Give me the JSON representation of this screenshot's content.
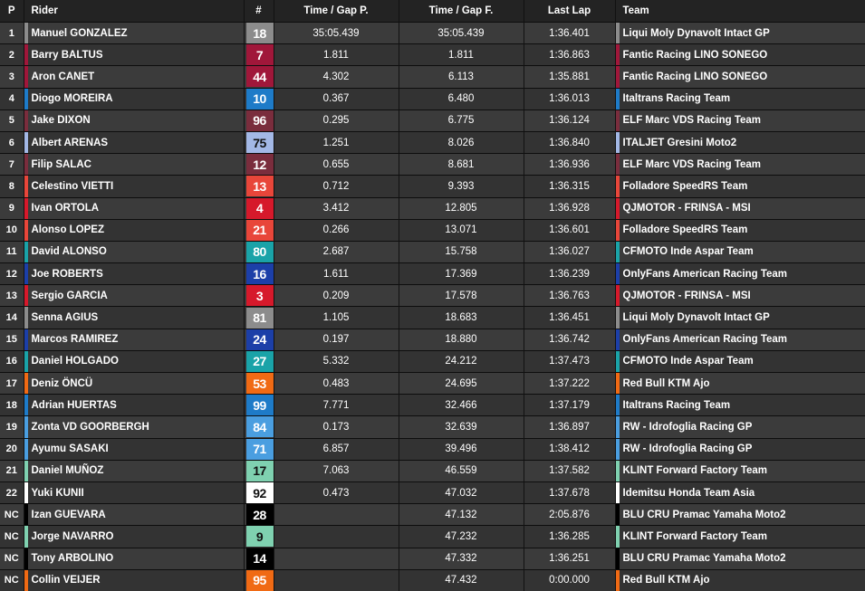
{
  "headers": {
    "p": "P",
    "rider": "Rider",
    "num": "#",
    "gap_prev": "Time / Gap P.",
    "gap_first": "Time / Gap F.",
    "last_lap": "Last Lap",
    "team": "Team"
  },
  "rows": [
    {
      "pos": "1",
      "rider": "Manuel GONZALEZ",
      "num": "18",
      "gap_prev": "35:05.439",
      "gap_first": "35:05.439",
      "last_lap": "1:36.401",
      "team": "Liqui Moly Dynavolt Intact GP",
      "color": "#8c8c8c",
      "text": "#ffffff"
    },
    {
      "pos": "2",
      "rider": "Barry BALTUS",
      "num": "7",
      "gap_prev": "1.811",
      "gap_first": "1.811",
      "last_lap": "1:36.863",
      "team": "Fantic Racing LINO SONEGO",
      "color": "#a0173a",
      "text": "#ffffff"
    },
    {
      "pos": "3",
      "rider": "Aron CANET",
      "num": "44",
      "gap_prev": "4.302",
      "gap_first": "6.113",
      "last_lap": "1:35.881",
      "team": "Fantic Racing LINO SONEGO",
      "color": "#a0173a",
      "text": "#ffffff"
    },
    {
      "pos": "4",
      "rider": "Diogo MOREIRA",
      "num": "10",
      "gap_prev": "0.367",
      "gap_first": "6.480",
      "last_lap": "1:36.013",
      "team": "Italtrans Racing Team",
      "color": "#1e7bc8",
      "text": "#ffffff"
    },
    {
      "pos": "5",
      "rider": "Jake DIXON",
      "num": "96",
      "gap_prev": "0.295",
      "gap_first": "6.775",
      "last_lap": "1:36.124",
      "team": "ELF Marc VDS Racing Team",
      "color": "#7a2d3d",
      "text": "#ffffff"
    },
    {
      "pos": "6",
      "rider": "Albert ARENAS",
      "num": "75",
      "gap_prev": "1.251",
      "gap_first": "8.026",
      "last_lap": "1:36.840",
      "team": "ITALJET Gresini Moto2",
      "color": "#a3b8e6",
      "text": "#111111"
    },
    {
      "pos": "7",
      "rider": "Filip SALAC",
      "num": "12",
      "gap_prev": "0.655",
      "gap_first": "8.681",
      "last_lap": "1:36.936",
      "team": "ELF Marc VDS Racing Team",
      "color": "#7a2d3d",
      "text": "#ffffff"
    },
    {
      "pos": "8",
      "rider": "Celestino VIETTI",
      "num": "13",
      "gap_prev": "0.712",
      "gap_first": "9.393",
      "last_lap": "1:36.315",
      "team": "Folladore SpeedRS Team",
      "color": "#e8463a",
      "text": "#ffffff"
    },
    {
      "pos": "9",
      "rider": "Ivan ORTOLA",
      "num": "4",
      "gap_prev": "3.412",
      "gap_first": "12.805",
      "last_lap": "1:36.928",
      "team": "QJMOTOR - FRINSA - MSI",
      "color": "#d6192b",
      "text": "#ffffff"
    },
    {
      "pos": "10",
      "rider": "Alonso LOPEZ",
      "num": "21",
      "gap_prev": "0.266",
      "gap_first": "13.071",
      "last_lap": "1:36.601",
      "team": "Folladore SpeedRS Team",
      "color": "#e8463a",
      "text": "#ffffff"
    },
    {
      "pos": "11",
      "rider": "David ALONSO",
      "num": "80",
      "gap_prev": "2.687",
      "gap_first": "15.758",
      "last_lap": "1:36.027",
      "team": "CFMOTO Inde Aspar Team",
      "color": "#1aa3a8",
      "text": "#ffffff"
    },
    {
      "pos": "12",
      "rider": "Joe ROBERTS",
      "num": "16",
      "gap_prev": "1.611",
      "gap_first": "17.369",
      "last_lap": "1:36.239",
      "team": "OnlyFans American Racing Team",
      "color": "#1c3fa8",
      "text": "#ffffff"
    },
    {
      "pos": "13",
      "rider": "Sergio GARCIA",
      "num": "3",
      "gap_prev": "0.209",
      "gap_first": "17.578",
      "last_lap": "1:36.763",
      "team": "QJMOTOR - FRINSA - MSI",
      "color": "#d6192b",
      "text": "#ffffff"
    },
    {
      "pos": "14",
      "rider": "Senna AGIUS",
      "num": "81",
      "gap_prev": "1.105",
      "gap_first": "18.683",
      "last_lap": "1:36.451",
      "team": "Liqui Moly Dynavolt Intact GP",
      "color": "#8c8c8c",
      "text": "#ffffff"
    },
    {
      "pos": "15",
      "rider": "Marcos RAMIREZ",
      "num": "24",
      "gap_prev": "0.197",
      "gap_first": "18.880",
      "last_lap": "1:36.742",
      "team": "OnlyFans American Racing Team",
      "color": "#1c3fa8",
      "text": "#ffffff"
    },
    {
      "pos": "16",
      "rider": "Daniel HOLGADO",
      "num": "27",
      "gap_prev": "5.332",
      "gap_first": "24.212",
      "last_lap": "1:37.473",
      "team": "CFMOTO Inde Aspar Team",
      "color": "#1aa3a8",
      "text": "#ffffff"
    },
    {
      "pos": "17",
      "rider": "Deniz ÖNCÜ",
      "num": "53",
      "gap_prev": "0.483",
      "gap_first": "24.695",
      "last_lap": "1:37.222",
      "team": "Red Bull KTM Ajo",
      "color": "#f06a14",
      "text": "#ffffff"
    },
    {
      "pos": "18",
      "rider": "Adrian HUERTAS",
      "num": "99",
      "gap_prev": "7.771",
      "gap_first": "32.466",
      "last_lap": "1:37.179",
      "team": "Italtrans Racing Team",
      "color": "#1e7bc8",
      "text": "#ffffff"
    },
    {
      "pos": "19",
      "rider": "Zonta VD GOORBERGH",
      "num": "84",
      "gap_prev": "0.173",
      "gap_first": "32.639",
      "last_lap": "1:36.897",
      "team": "RW - Idrofoglia Racing GP",
      "color": "#4a9ee0",
      "text": "#ffffff"
    },
    {
      "pos": "20",
      "rider": "Ayumu SASAKI",
      "num": "71",
      "gap_prev": "6.857",
      "gap_first": "39.496",
      "last_lap": "1:38.412",
      "team": "RW - Idrofoglia Racing GP",
      "color": "#4a9ee0",
      "text": "#ffffff"
    },
    {
      "pos": "21",
      "rider": "Daniel MUÑOZ",
      "num": "17",
      "gap_prev": "7.063",
      "gap_first": "46.559",
      "last_lap": "1:37.582",
      "team": "KLINT Forward Factory Team",
      "color": "#7fd1b0",
      "text": "#111111"
    },
    {
      "pos": "22",
      "rider": "Yuki KUNII",
      "num": "92",
      "gap_prev": "0.473",
      "gap_first": "47.032",
      "last_lap": "1:37.678",
      "team": "Idemitsu Honda Team Asia",
      "color": "#ffffff",
      "text": "#111111"
    },
    {
      "pos": "NC",
      "rider": "Izan GUEVARA",
      "num": "28",
      "gap_prev": "",
      "gap_first": "47.132",
      "last_lap": "2:05.876",
      "team": "BLU CRU Pramac Yamaha Moto2",
      "color": "#000000",
      "text": "#ffffff"
    },
    {
      "pos": "NC",
      "rider": "Jorge NAVARRO",
      "num": "9",
      "gap_prev": "",
      "gap_first": "47.232",
      "last_lap": "1:36.285",
      "team": "KLINT Forward Factory Team",
      "color": "#7fd1b0",
      "text": "#111111"
    },
    {
      "pos": "NC",
      "rider": "Tony ARBOLINO",
      "num": "14",
      "gap_prev": "",
      "gap_first": "47.332",
      "last_lap": "1:36.251",
      "team": "BLU CRU Pramac Yamaha Moto2",
      "color": "#000000",
      "text": "#ffffff"
    },
    {
      "pos": "NC",
      "rider": "Collin VEIJER",
      "num": "95",
      "gap_prev": "",
      "gap_first": "47.432",
      "last_lap": "0:00.000",
      "team": "Red Bull KTM Ajo",
      "color": "#f06a14",
      "text": "#ffffff"
    }
  ]
}
